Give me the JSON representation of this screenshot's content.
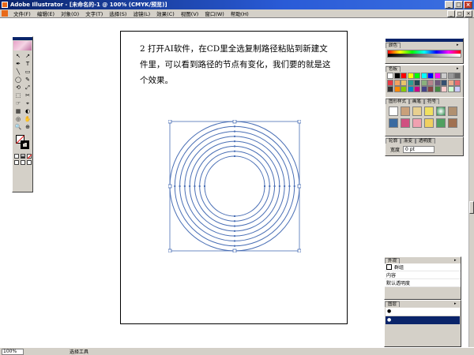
{
  "window": {
    "title": "Adobe Illustrator - [未命名的-1 @ 100% (CMYK/预览)]",
    "buttons": [
      "_",
      "□",
      "×"
    ]
  },
  "menubar": {
    "items": [
      "文件(F)",
      "编辑(E)",
      "对象(O)",
      "文字(T)",
      "选择(S)",
      "滤镜(L)",
      "效果(C)",
      "视图(V)",
      "窗口(W)",
      "帮助(H)"
    ],
    "doc_buttons": [
      "_",
      "□",
      "×"
    ]
  },
  "toolbox": {
    "tools": [
      "↖",
      "↗",
      "✒",
      "T",
      "╲",
      "▭",
      "◯",
      "✎",
      "⟲",
      "⤢",
      "⬚",
      "✂",
      "☞",
      "⌖",
      "▦",
      "◐",
      "◎",
      "✋",
      "🔍",
      "⊕"
    ]
  },
  "document": {
    "text": "2 打开AI软件，在CD里全选复制路径粘贴到新建文件里，可以看到路径的节点有变化，我们要的就是这个效果。"
  },
  "rings": {
    "count": 8,
    "color": "#4a6fb5"
  },
  "panels": {
    "color": {
      "tab": "颜色"
    },
    "swatches": {
      "tab": "色板",
      "colors": [
        "#ffffff",
        "#000000",
        "#ff0000",
        "#ffff00",
        "#00ff00",
        "#00ffff",
        "#0000ff",
        "#ff00ff",
        "#cccccc",
        "#999999",
        "#666666",
        "#e63946",
        "#f4a261",
        "#e9c46a",
        "#2a9d8f",
        "#264653",
        "#8ab17d",
        "#b5838d",
        "#6d597a",
        "#355070",
        "#eaac8b",
        "#e56b6f",
        "#333333",
        "#ff8800",
        "#88cc00",
        "#0088cc",
        "#cc0088",
        "#444488",
        "#884444",
        "#448844",
        "#ffcccc",
        "#ccffcc",
        "#ccccff"
      ]
    },
    "styles": {
      "tabs": [
        "图形样式",
        "画笔",
        "符号"
      ]
    },
    "stroke": {
      "tabs": [
        "轮廓",
        "渐变",
        "透明度"
      ],
      "label": "宽度",
      "value": "0 pt"
    },
    "appearance": {
      "tab": "外观",
      "rows": [
        "群组",
        "内容",
        "默认透明度"
      ]
    },
    "layers": {
      "tab": "图层"
    }
  },
  "statusbar": {
    "zoom": "100%",
    "tool": "选择工具"
  }
}
